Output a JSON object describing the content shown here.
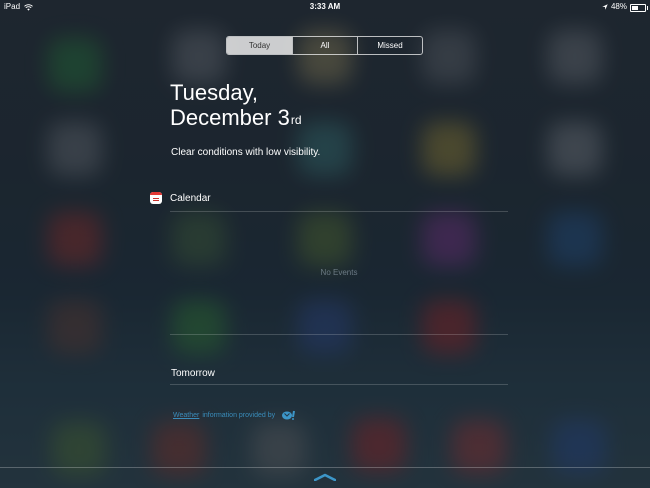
{
  "status_bar": {
    "device": "iPad",
    "time": "3:33 AM",
    "battery_percent": "48%",
    "battery_level": 0.48
  },
  "tabs": [
    {
      "label": "Today",
      "active": true
    },
    {
      "label": "All",
      "active": false
    },
    {
      "label": "Missed",
      "active": false
    }
  ],
  "today": {
    "weekday": "Tuesday,",
    "date": "December 3",
    "date_suffix": "rd",
    "weather_summary": "Clear conditions with low visibility."
  },
  "calendar": {
    "title": "Calendar",
    "no_events": "No Events",
    "tomorrow_label": "Tomorrow"
  },
  "attribution": {
    "link_text": "Weather",
    "text": "information provided by",
    "provider_logo": "yahoo-logo"
  },
  "colors": {
    "accent": "#3c96c8",
    "calendar_red": "#e53935"
  }
}
